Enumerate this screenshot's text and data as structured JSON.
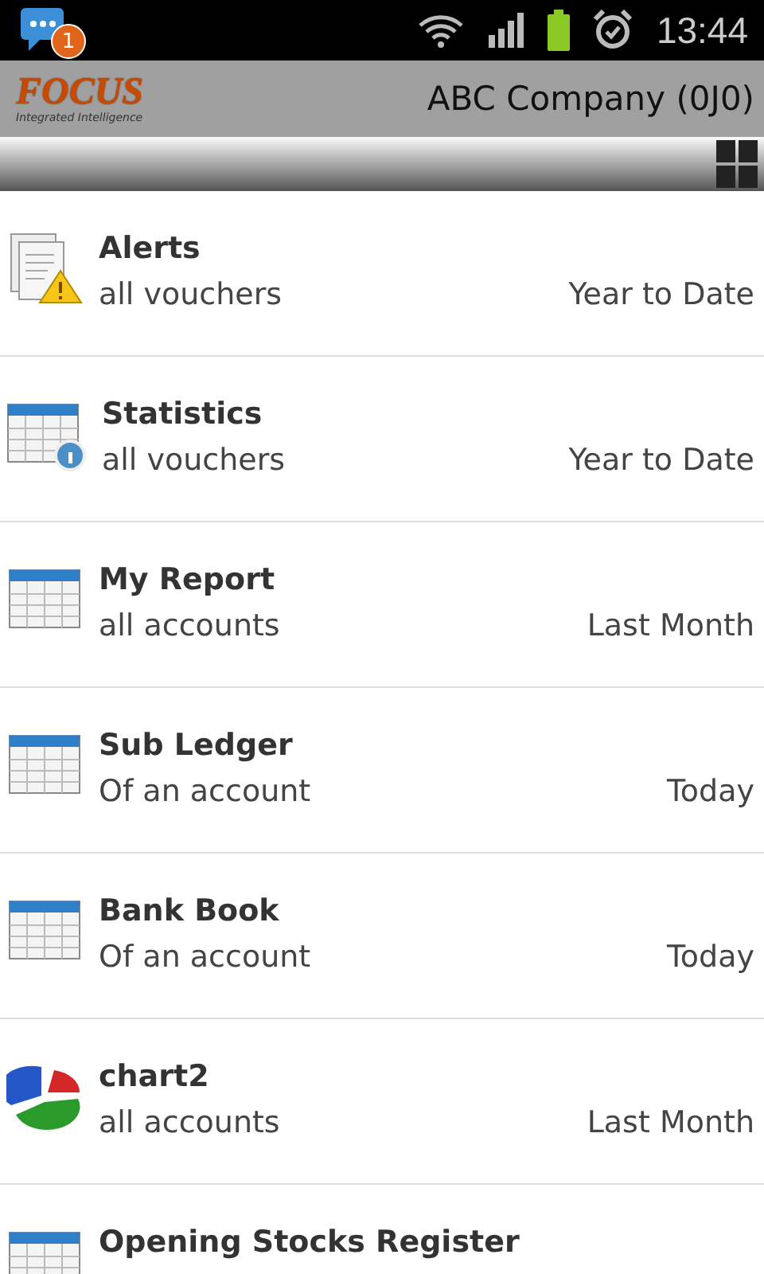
{
  "status_bar": {
    "notification_count": "1",
    "time": "13:44"
  },
  "header": {
    "logo": "FOCUS",
    "tagline": "Integrated Intelligence",
    "company": "ABC Company (0J0)"
  },
  "reports": [
    {
      "kind": "alert",
      "title": "Alerts",
      "scope": "all vouchers",
      "period": "Year to Date"
    },
    {
      "kind": "statistics",
      "title": "Statistics",
      "scope": "all vouchers",
      "period": "Year to Date"
    },
    {
      "kind": "table",
      "title": "My Report",
      "scope": "all accounts",
      "period": "Last Month"
    },
    {
      "kind": "table",
      "title": "Sub Ledger",
      "scope": "Of an account",
      "period": "Today"
    },
    {
      "kind": "table",
      "title": "Bank Book",
      "scope": "Of an account",
      "period": "Today"
    },
    {
      "kind": "pie",
      "title": "chart2",
      "scope": "all accounts",
      "period": "Last Month"
    },
    {
      "kind": "table",
      "title": "Opening Stocks Register"
    }
  ]
}
